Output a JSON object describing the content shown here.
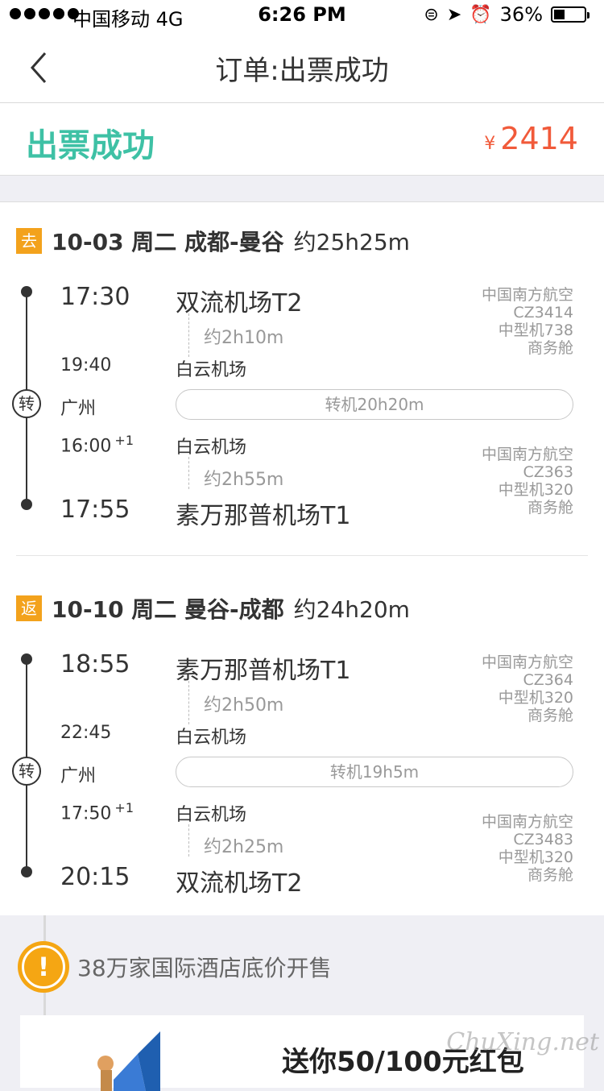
{
  "status_bar": {
    "carrier": "中国移动",
    "network": "4G",
    "time": "6:26 PM",
    "battery": "36%",
    "battery_level": 0.36,
    "icons": [
      "signal-dots-icon",
      "rotation-lock-icon",
      "location-arrow-icon",
      "alarm-icon",
      "battery-icon"
    ]
  },
  "nav": {
    "title": "订单:出票成功",
    "back_icon": "chevron-left-icon"
  },
  "summary": {
    "status": "出票成功",
    "currency": "¥",
    "price": "2414"
  },
  "colors": {
    "status_green": "#3ec1a5",
    "price_red": "#f15a3a",
    "badge_orange": "#f3a21c",
    "promo_orange": "#f5a613"
  },
  "outbound": {
    "badge": "去",
    "date_route": "10-03 周二 成都-曼谷",
    "duration": "约25h25m",
    "leg1": {
      "dep_time": "17:30",
      "dep_airport": "双流机场T2",
      "flight_duration": "约2h10m",
      "arr_time": "19:40",
      "arr_airport": "白云机场",
      "airline": "中国南方航空",
      "flight_no": "CZ3414",
      "aircraft": "中型机738",
      "cabin": "商务舱"
    },
    "transfer": {
      "icon_label": "转",
      "city": "广州",
      "wait": "转机20h20m"
    },
    "leg2": {
      "dep_time": "16:00",
      "dep_plus": "+1",
      "dep_airport": "白云机场",
      "flight_duration": "约2h55m",
      "arr_time": "17:55",
      "arr_airport": "素万那普机场T1",
      "airline": "中国南方航空",
      "flight_no": "CZ363",
      "aircraft": "中型机320",
      "cabin": "商务舱"
    }
  },
  "return": {
    "badge": "返",
    "date_route": "10-10 周二 曼谷-成都",
    "duration": "约24h20m",
    "leg1": {
      "dep_time": "18:55",
      "dep_airport": "素万那普机场T1",
      "flight_duration": "约2h50m",
      "arr_time": "22:45",
      "arr_airport": "白云机场",
      "airline": "中国南方航空",
      "flight_no": "CZ364",
      "aircraft": "中型机320",
      "cabin": "商务舱"
    },
    "transfer": {
      "icon_label": "转",
      "city": "广州",
      "wait": "转机19h5m"
    },
    "leg2": {
      "dep_time": "17:50",
      "dep_plus": "+1",
      "dep_airport": "白云机场",
      "flight_duration": "约2h25m",
      "arr_time": "20:15",
      "arr_airport": "双流机场T2",
      "airline": "中国南方航空",
      "flight_no": "CZ3483",
      "aircraft": "中型机320",
      "cabin": "商务舱"
    }
  },
  "promo": {
    "icon": "exclamation-icon",
    "icon_label": "!",
    "text": "38万家国际酒店底价开售",
    "banner": "送你50/100元红包",
    "watermark": "ChuXing.net"
  }
}
